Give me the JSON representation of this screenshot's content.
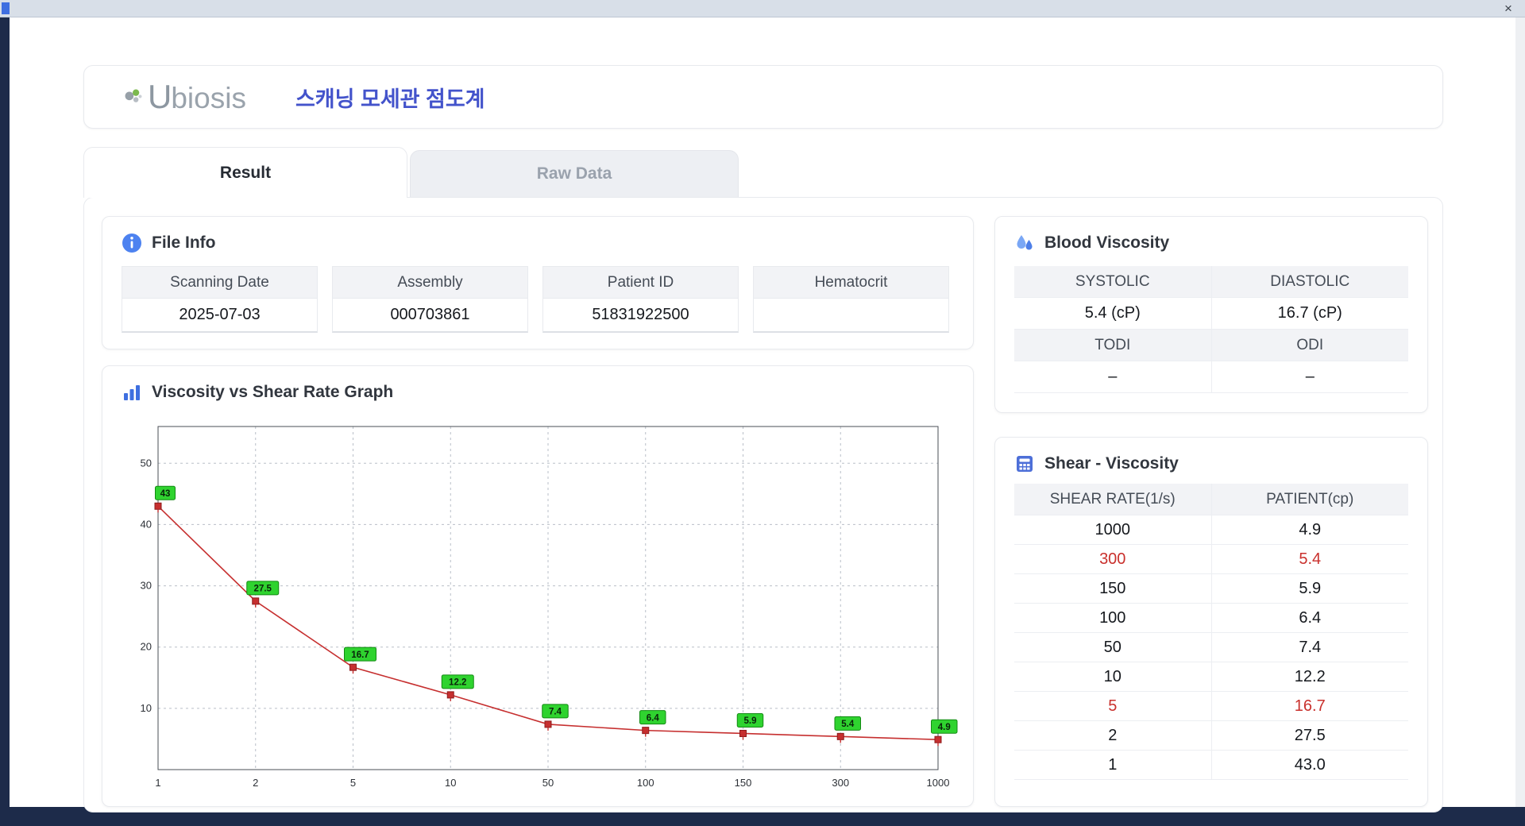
{
  "window": {
    "close": "×"
  },
  "header": {
    "logo_u": "U",
    "logo_rest": "biosis",
    "app_title": "스캐닝 모세관 점도계"
  },
  "tabs": {
    "result": "Result",
    "raw_data": "Raw Data"
  },
  "file_info": {
    "title": "File Info",
    "fields": [
      {
        "label": "Scanning Date",
        "value": "2025-07-03"
      },
      {
        "label": "Assembly",
        "value": "000703861"
      },
      {
        "label": "Patient ID",
        "value": "51831922500"
      },
      {
        "label": "Hematocrit",
        "value": ""
      }
    ]
  },
  "blood_viscosity": {
    "title": "Blood Viscosity",
    "groups": [
      {
        "labels": [
          "SYSTOLIC",
          "DIASTOLIC"
        ],
        "values": [
          "5.4 (cP)",
          "16.7 (cP)"
        ]
      },
      {
        "labels": [
          "TODI",
          "ODI"
        ],
        "values": [
          "–",
          "–"
        ]
      }
    ]
  },
  "shear_viscosity": {
    "title": "Shear - Viscosity",
    "columns": [
      "SHEAR RATE(1/s)",
      "PATIENT(cp)"
    ],
    "rows": [
      {
        "shear": "1000",
        "patient": "4.9",
        "highlight": false
      },
      {
        "shear": "300",
        "patient": "5.4",
        "highlight": true
      },
      {
        "shear": "150",
        "patient": "5.9",
        "highlight": false
      },
      {
        "shear": "100",
        "patient": "6.4",
        "highlight": false
      },
      {
        "shear": "50",
        "patient": "7.4",
        "highlight": false
      },
      {
        "shear": "10",
        "patient": "12.2",
        "highlight": false
      },
      {
        "shear": "5",
        "patient": "16.7",
        "highlight": true
      },
      {
        "shear": "2",
        "patient": "27.5",
        "highlight": false
      },
      {
        "shear": "1",
        "patient": "43.0",
        "highlight": false
      }
    ]
  },
  "chart_data": {
    "type": "line",
    "title": "Viscosity vs Shear Rate Graph",
    "x_categories": [
      "1",
      "2",
      "5",
      "10",
      "50",
      "100",
      "150",
      "300",
      "1000"
    ],
    "values": [
      43,
      27.5,
      16.7,
      12.2,
      7.4,
      6.4,
      5.9,
      5.4,
      4.9
    ],
    "point_labels": [
      "43",
      "27.5",
      "16.7",
      "12.2",
      "7.4",
      "6.4",
      "5.9",
      "5.4",
      "4.9"
    ],
    "xlabel": "",
    "ylabel": "",
    "y_ticks": [
      10,
      20,
      30,
      40,
      50
    ],
    "ylim": [
      0,
      56
    ],
    "x_axis_type": "categorical-evenly-spaced",
    "grid": true,
    "legend": false,
    "line_color": "#c62f2f",
    "marker_color": "#c62f2f",
    "marker_border": "#8e1b1b",
    "point_label_bg": "#2fd32f",
    "point_label_border": "#128a12"
  },
  "colors": {
    "accent_blue": "#4353cb",
    "highlight_red": "#c9302c",
    "band_gray": "#f2f3f6"
  }
}
